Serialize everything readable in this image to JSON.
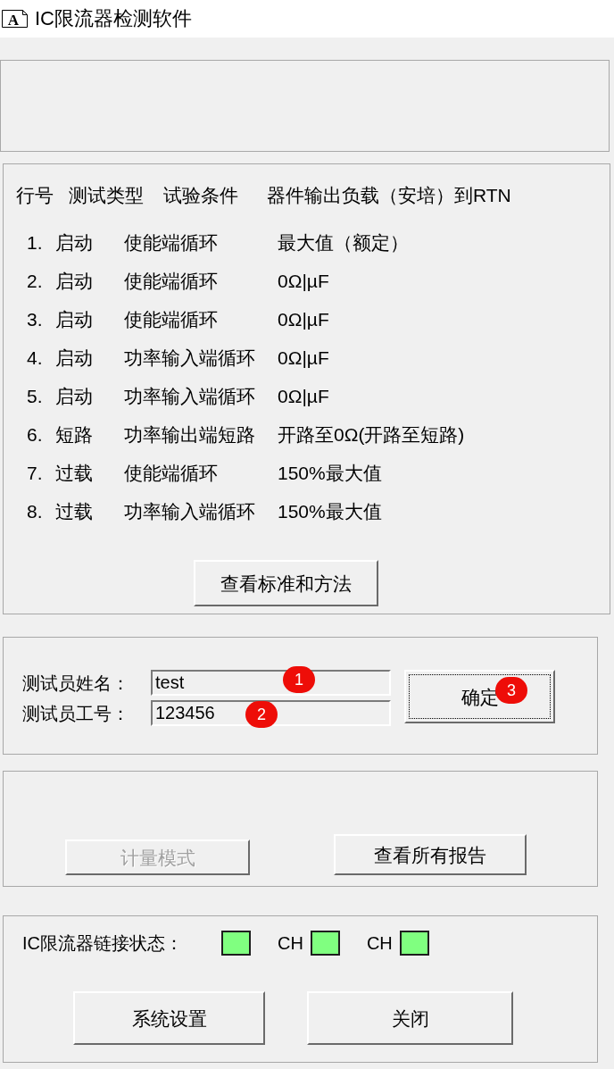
{
  "window": {
    "icon_letter": "A",
    "title": "IC限流器检测软件"
  },
  "test_list": {
    "header": [
      "行号",
      "测试类型",
      "试验条件",
      "器件输出负载（安培）到RTN"
    ],
    "rows": [
      {
        "number": "1.",
        "type": "启动",
        "condition": "使能端循环",
        "load": "最大值（额定）"
      },
      {
        "number": "2.",
        "type": "启动",
        "condition": "使能端循环",
        "load": "0Ω|µF"
      },
      {
        "number": "3.",
        "type": "启动",
        "condition": "使能端循环",
        "load": "0Ω|µF"
      },
      {
        "number": "4.",
        "type": "启动",
        "condition": "功率输入端循环",
        "load": "0Ω|µF"
      },
      {
        "number": "5.",
        "type": "启动",
        "condition": "功率输入端循环",
        "load": "0Ω|µF"
      },
      {
        "number": "6.",
        "type": "短路",
        "condition": "功率输出端短路",
        "load": "开路至0Ω(开路至短路)"
      },
      {
        "number": "7.",
        "type": "过载",
        "condition": "使能端循环",
        "load": "150%最大值"
      },
      {
        "number": "8.",
        "type": "过载",
        "condition": "功率输入端循环",
        "load": "150%最大值"
      }
    ],
    "button": {
      "label": "查看标准和方法",
      "disabled": false
    }
  },
  "tester": {
    "fields": [
      {
        "label": "测试员姓名：",
        "value": "test",
        "marker": "1"
      },
      {
        "label": "测试员工号：",
        "value": "123456",
        "marker": "2"
      }
    ],
    "confirm_button": {
      "label": "确定",
      "focused": true,
      "disabled": false,
      "marker": "3"
    }
  },
  "modes": {
    "buttons": [
      {
        "label": "计量模式",
        "disabled": true
      },
      {
        "label": "查看所有报告",
        "disabled": false
      }
    ]
  },
  "status": {
    "label": "IC限流器链接状态：",
    "indicators": [
      {
        "connected": true
      },
      {
        "label": "CH",
        "connected": true
      },
      {
        "label": "CH",
        "connected": true
      }
    ],
    "buttons": [
      {
        "label": "系统设置",
        "disabled": false
      },
      {
        "label": "关闭",
        "disabled": false
      }
    ]
  }
}
